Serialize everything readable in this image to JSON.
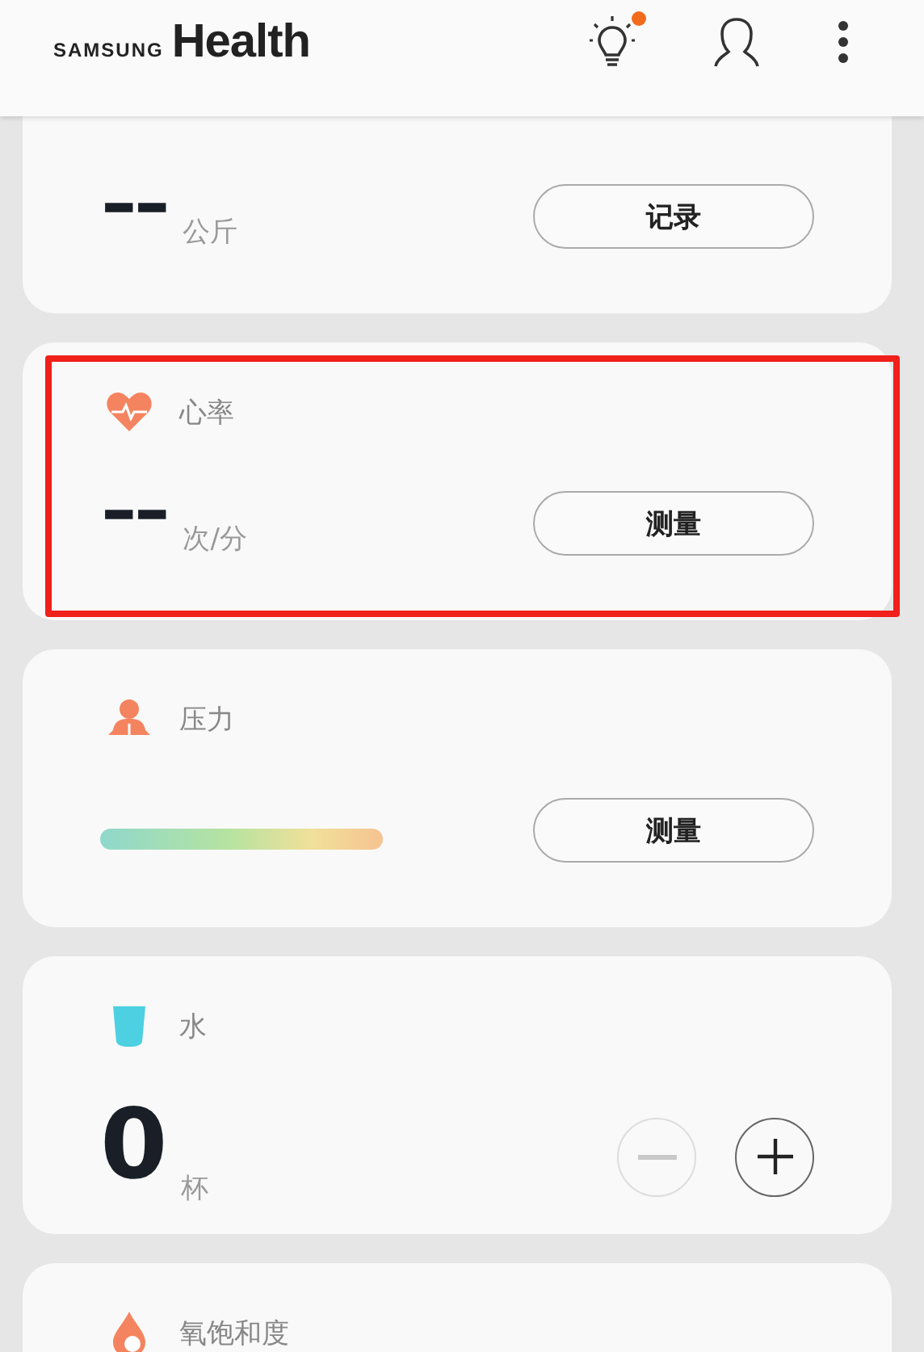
{
  "header": {
    "brand_small": "SAMSUNG",
    "brand_large": "Health",
    "tips_badge": true
  },
  "cards": [
    {
      "kind": "weight",
      "value": "--",
      "unit": "公斤",
      "button": "记录",
      "highlighted": false
    },
    {
      "kind": "heart_rate",
      "title": "心率",
      "value": "--",
      "unit": "次/分",
      "button": "测量",
      "highlighted": true
    },
    {
      "kind": "stress",
      "title": "压力",
      "button": "测量",
      "highlighted": false
    },
    {
      "kind": "water",
      "title": "水",
      "value": "0",
      "unit": "杯",
      "decrease_disabled": true,
      "highlighted": false
    },
    {
      "kind": "oxygen",
      "title": "氧饱和度",
      "highlighted": false
    }
  ]
}
